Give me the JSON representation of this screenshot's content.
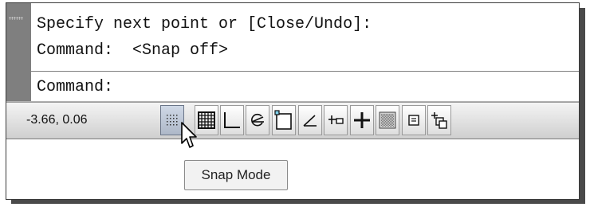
{
  "command_window": {
    "history_line_1": "Specify next point or [Close/Undo]:",
    "history_line_2": "Command:  <Snap off>",
    "prompt": "Command:"
  },
  "status_bar": {
    "coordinates": "-3.66, 0.06",
    "buttons": [
      {
        "icon": "snap-mode-icon",
        "state": "hover"
      },
      {
        "icon": "grid-display-icon",
        "state": "off"
      },
      {
        "icon": "ortho-mode-icon",
        "state": "off"
      },
      {
        "icon": "polar-tracking-icon",
        "state": "off"
      },
      {
        "icon": "object-snap-icon",
        "state": "off"
      },
      {
        "icon": "object-snap-tracking-icon",
        "state": "off"
      },
      {
        "icon": "dynamic-ucs-icon",
        "state": "off"
      },
      {
        "icon": "dynamic-input-icon",
        "state": "off"
      },
      {
        "icon": "lineweight-icon",
        "state": "off"
      },
      {
        "icon": "transparency-icon",
        "state": "off"
      },
      {
        "icon": "quick-properties-icon",
        "state": "off"
      }
    ]
  },
  "tooltip": {
    "text": "Snap Mode"
  }
}
